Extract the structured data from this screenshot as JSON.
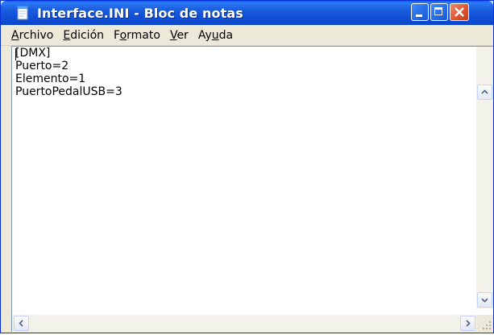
{
  "window": {
    "title": "Interface.INI - Bloc de notas",
    "icon": "notepad-icon"
  },
  "menu": [
    {
      "accel": "A",
      "rest": "rchivo"
    },
    {
      "accel": "E",
      "rest": "dición"
    },
    {
      "pre": "F",
      "accel": "o",
      "rest": "rmato"
    },
    {
      "accel": "V",
      "rest": "er"
    },
    {
      "pre": "Ay",
      "accel": "u",
      "rest": "da"
    }
  ],
  "document": {
    "text": "[DMX]\nPuerto=2\nElemento=1\nPuertoPedalUSB=3"
  },
  "colors": {
    "titlebar": "#0b55e0",
    "close_button": "#e05a36",
    "editor_bg": "#ffffff"
  }
}
